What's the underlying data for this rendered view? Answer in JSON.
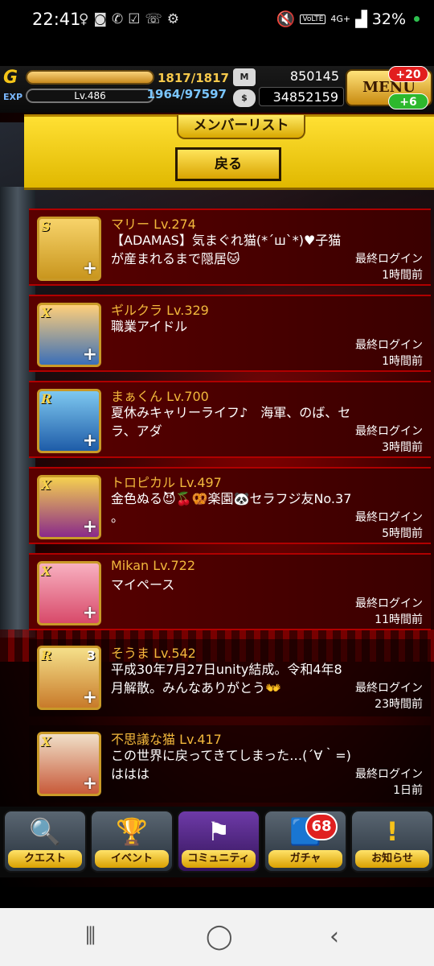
{
  "status_bar": {
    "time": "22:41",
    "volte": "VoLTE",
    "network": "4G+",
    "battery": "32%"
  },
  "hud": {
    "rank_letter": "G",
    "exp_label": "EXP",
    "level": "Lv.486",
    "stamina": "1817/1817",
    "exp": "1964/97597",
    "members_icon": "M",
    "members_count": "850145",
    "money": "34852159",
    "menu_label": "MENU",
    "badge_top": "+20",
    "badge_bottom": "+6"
  },
  "panel": {
    "title": "メンバーリスト",
    "back_label": "戻る"
  },
  "members": [
    {
      "name": "マリー Lv.274",
      "message": "【ADAMAS】気まぐれ猫(*´ш`*)♥子猫が産まれるまで隠居🐱",
      "login_label": "最終ログイン",
      "login_time": "1時間前",
      "rank": "S"
    },
    {
      "name": "ギルクラ Lv.329",
      "message": "職業アイドル",
      "login_label": "最終ログイン",
      "login_time": "1時間前",
      "rank": "X"
    },
    {
      "name": "まぁくん Lv.700",
      "message": "夏休みキャリーライフ♪　海軍、のば、セラ、アダ",
      "login_label": "最終ログイン",
      "login_time": "3時間前",
      "rank": "R"
    },
    {
      "name": "トロピカル Lv.497",
      "message": "金色ぬる😈🍒🥨楽園🐼セラフジ友No.37 。",
      "login_label": "最終ログイン",
      "login_time": "5時間前",
      "rank": "X"
    },
    {
      "name": "Mikan Lv.722",
      "message": "マイペース",
      "login_label": "最終ログイン",
      "login_time": "11時間前",
      "rank": "X"
    },
    {
      "name": "そうま Lv.542",
      "message": "平成30年7月27日unity結成。令和4年8月解散。みんなありがとう👐",
      "login_label": "最終ログイン",
      "login_time": "23時間前",
      "rank": "R"
    },
    {
      "name": "不思議な猫 Lv.417",
      "message": "この世界に戻ってきてしまった…(´∀｀=)ははは",
      "login_label": "最終ログイン",
      "login_time": "1日前",
      "rank": "X"
    }
  ],
  "bottom_nav": {
    "quest": "クエスト",
    "event": "イベント",
    "community": "コミュニティ",
    "gacha": "ガチャ",
    "gacha_badge": "68",
    "news": "お知らせ"
  },
  "colors": {
    "name_color": "#f2b83c",
    "panel_yellow": "#ffe033",
    "active_nav": "#6e3aa8"
  }
}
